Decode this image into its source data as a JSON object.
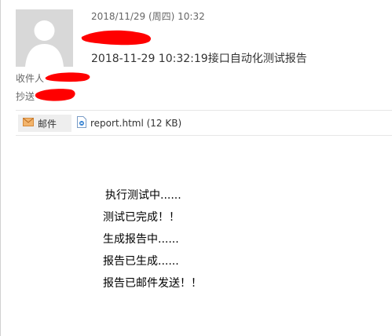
{
  "message": {
    "date": "2018/11/29 (周四) 10:32",
    "subject": "2018-11-29 10:32:19接口自动化测试报告"
  },
  "recipients": {
    "to_label": "收件人",
    "cc_label": "抄送"
  },
  "attachments": {
    "mail_label": "邮件",
    "file_label": "report.html (12 KB)",
    "mail_icon": "envelope-icon",
    "file_icon": "html-file-icon"
  },
  "body": {
    "lines": [
      "执行测试中......",
      "测试已完成！！",
      "生成报告中......",
      "报告已生成......",
      "报告已邮件发送！！"
    ]
  },
  "colors": {
    "redaction": "#ff0000",
    "mail_icon": "#e8a25b"
  }
}
